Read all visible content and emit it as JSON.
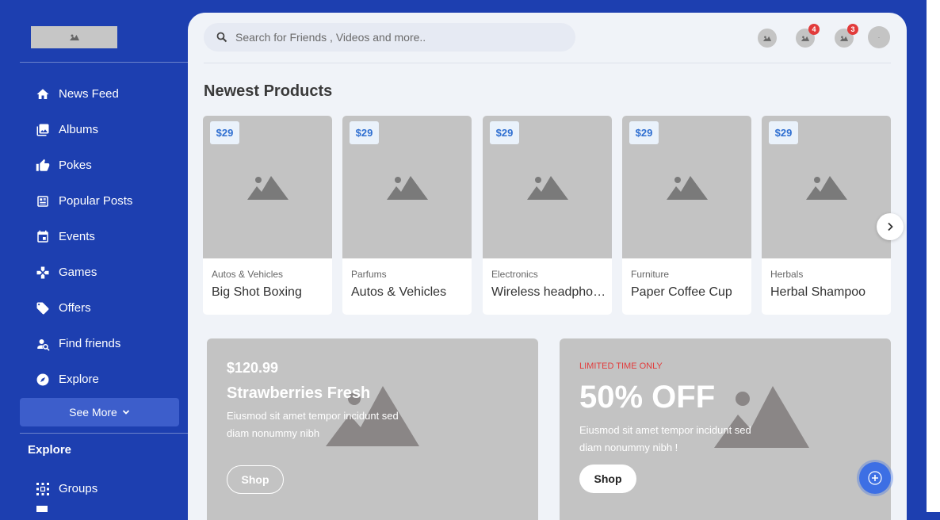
{
  "sidebar": {
    "logo_icon": "image-placeholder-icon",
    "items": [
      {
        "label": "News Feed",
        "icon": "home-icon"
      },
      {
        "label": "Albums",
        "icon": "photo-album-icon"
      },
      {
        "label": "Pokes",
        "icon": "thumb-up-icon"
      },
      {
        "label": "Popular Posts",
        "icon": "article-icon"
      },
      {
        "label": "Events",
        "icon": "calendar-icon"
      },
      {
        "label": "Games",
        "icon": "gamepad-icon"
      },
      {
        "label": "Offers",
        "icon": "tag-icon"
      },
      {
        "label": "Find friends",
        "icon": "person-search-icon"
      },
      {
        "label": "Explore",
        "icon": "compass-icon"
      }
    ],
    "see_more": "See More",
    "explore_heading": "Explore",
    "groups_label": "Groups"
  },
  "header": {
    "search_placeholder": "Search for Friends , Videos and more..",
    "notifications": [
      {
        "icon": "image-placeholder-icon",
        "badge": ""
      },
      {
        "icon": "image-placeholder-icon",
        "badge": "4"
      },
      {
        "icon": "image-placeholder-icon",
        "badge": "3"
      }
    ],
    "avatar_text": "·"
  },
  "main": {
    "section_title": "Newest Products",
    "products": [
      {
        "price": "$29",
        "category": "Autos & Vehicles",
        "name": "Big Shot Boxing"
      },
      {
        "price": "$29",
        "category": "Parfums",
        "name": "Autos & Vehicles"
      },
      {
        "price": "$29",
        "category": "Electronics",
        "name": "Wireless headphones"
      },
      {
        "price": "$29",
        "category": "Furniture",
        "name": "Paper Coffee Cup"
      },
      {
        "price": "$29",
        "category": "Herbals",
        "name": "Herbal Shampoo"
      }
    ],
    "banner1": {
      "price": "$120.99",
      "title": "Strawberries Fresh",
      "desc_line1": "Eiusmod sit amet tempor incidunt sed",
      "desc_line2": "diam nonummy nibh",
      "button": "Shop"
    },
    "banner2": {
      "tag": "LIMITED TIME ONLY",
      "title": "50% OFF",
      "desc_line1": "Eiusmod sit amet tempor incidunt sed",
      "desc_line2": "diam nonummy nibh !",
      "button": "Shop"
    }
  },
  "colors": {
    "sidebar_bg": "#1d3fb0",
    "accent_blue": "#2f6fd1",
    "badge_red": "#e23b3b",
    "fab_blue": "#3d6fe4"
  }
}
